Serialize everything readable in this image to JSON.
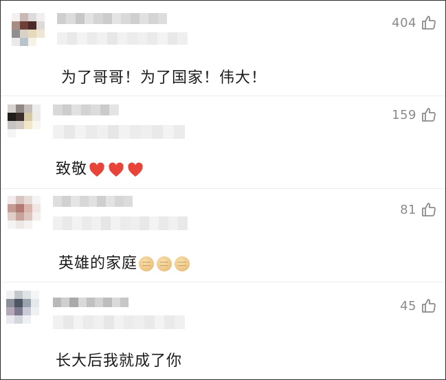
{
  "comments": [
    {
      "likes": "404",
      "text": "为了哥哥！为了国家！伟大！",
      "emoji": [],
      "avatar_colors": [
        [
          "#f4f0ef",
          "#c9b8b3",
          "#dcdcdc",
          "#f0eeee",
          "#ffffff"
        ],
        [
          "#a68c82",
          "#6f3e37",
          "#4a2b2a",
          "#dedad7",
          "#ffffff"
        ],
        [
          "#8f8f90",
          "#d7d1c8",
          "#e8d9ba",
          "#efe5d3",
          "#ffffff"
        ],
        [
          "#e8eaec",
          "#b8c3cb",
          "#f6f2e7",
          "#ffffff",
          "#ffffff"
        ],
        [
          "#ffffff",
          "#ffffff",
          "#ffffff",
          "#ffffff",
          "#ffffff"
        ]
      ],
      "name_blur": [
        "#cfcfcf",
        "#dcdcdc",
        "#c7c7c7",
        "#e2e2e2",
        "#d5d5d5",
        "#cccccc",
        "#e4e4e4",
        "#d9d9d9",
        "#cfcfcf",
        "#e0e0e0",
        "#d4d4d4",
        "#dddddd"
      ],
      "sub_blur": [
        "#f0f0f0",
        "#e9e9e9",
        "#f3f3f3",
        "#ebebeb",
        "#f1f1f1",
        "#e7e7e7",
        "#f2f2f2",
        "#ececec",
        "#f0f0f0",
        "#eaeaea",
        "#f3f3f3",
        "#e8e8e8",
        "#efefef"
      ]
    },
    {
      "likes": "159",
      "text": "致敬",
      "emoji": [
        "heart",
        "heart",
        "heart"
      ],
      "avatar_colors": [
        [
          "#d7d2cf",
          "#8f8884",
          "#c4bdb8",
          "#ececec",
          "#ffffff"
        ],
        [
          "#1f1c1c",
          "#3d2d2b",
          "#d8c9a5",
          "#ecebe7",
          "#ffffff"
        ],
        [
          "#c6c3c2",
          "#d2cbc4",
          "#f2e7c6",
          "#f8f6f1",
          "#ffffff"
        ],
        [
          "#f4f4f4",
          "#ffffff",
          "#ffffff",
          "#ffffff",
          "#ffffff"
        ],
        [
          "#ffffff",
          "#ffffff",
          "#ffffff",
          "#ffffff",
          "#ffffff"
        ]
      ],
      "name_blur": [
        "#d9d9d9",
        "#cdcdcd",
        "#e1e1e1",
        "#d3d3d3",
        "#dcdcdc",
        "#cbcbcb",
        "#e4e4e4"
      ],
      "sub_blur": [
        "#f1f1f1",
        "#e8e8e8",
        "#f3f3f3",
        "#ebebeb",
        "#f0f0f0",
        "#e6e6e6",
        "#f2f2f2",
        "#ececec",
        "#efefef",
        "#e9e9e9",
        "#f3f3f3",
        "#ebebeb"
      ]
    },
    {
      "likes": "81",
      "text": "英雄的家庭",
      "emoji": [
        "fist",
        "fist",
        "fist"
      ],
      "avatar_colors": [
        [
          "#f1eceb",
          "#d8c5c0",
          "#e6dcd8",
          "#f4f4f4",
          "#ffffff"
        ],
        [
          "#c49a92",
          "#b27c74",
          "#d9b6ad",
          "#efe6e3",
          "#ffffff"
        ],
        [
          "#e0cfc9",
          "#c7a39c",
          "#dcc5bf",
          "#f3efee",
          "#ffffff"
        ],
        [
          "#f6f4f3",
          "#ede7e5",
          "#f5f2f1",
          "#ffffff",
          "#ffffff"
        ],
        [
          "#ffffff",
          "#ffffff",
          "#ffffff",
          "#ffffff",
          "#ffffff"
        ]
      ],
      "name_blur": [
        "#dedede",
        "#d1d1d1",
        "#e5e5e5",
        "#d7d7d7",
        "#e1e1e1",
        "#cfcfcf",
        "#e3e3e3",
        "#d6d6d6",
        "#dcdcdc"
      ],
      "sub_blur": [
        "#f0f0f0",
        "#e9e9e9",
        "#f3f3f3",
        "#ebebeb",
        "#f1f1f1",
        "#e6e6e6",
        "#f2f2f2",
        "#ececec",
        "#efefef",
        "#e8e8e8",
        "#f3f3f3",
        "#eaeaea",
        "#f0f0f0",
        "#e9e9e9"
      ]
    },
    {
      "likes": "45",
      "text": "长大后我就成了你",
      "emoji": [],
      "avatar_colors": [
        [
          "#eef0f2",
          "#c3c8cd",
          "#dfe3e6",
          "#f4f5f6",
          "#ffffff"
        ],
        [
          "#8a8f9c",
          "#4e5663",
          "#9aa3ae",
          "#e6e9ec",
          "#ffffff"
        ],
        [
          "#b4a8b9",
          "#7d7a8f",
          "#c9cbd6",
          "#eef0f3",
          "#ffffff"
        ],
        [
          "#e9e8ee",
          "#d4d6de",
          "#eef0f4",
          "#ffffff",
          "#ffffff"
        ],
        [
          "#ffffff",
          "#ffffff",
          "#ffffff",
          "#ffffff",
          "#ffffff"
        ]
      ],
      "name_blur": [
        "#b9b9b9",
        "#cfcfcf",
        "#a9a9a9",
        "#d9d9d9",
        "#c1c1c1",
        "#d3d3d3",
        "#bdbdbd",
        "#dadada",
        "#c7c7c7"
      ],
      "sub_blur": [
        "#f1f1f1",
        "#e8e8e8",
        "#f3f3f3",
        "#ebebeb",
        "#f0f0f0",
        "#e7e7e7",
        "#f2f2f2",
        "#ececec",
        "#efefef",
        "#e9e9e9",
        "#f3f3f3",
        "#eaeaea",
        "#f0f0f0"
      ]
    }
  ],
  "colors": {
    "text": "#1a1a1a",
    "muted": "#8a8a8a",
    "divider": "#ececec",
    "heart": "#e8443a"
  },
  "icons": {
    "like": "thumbs-up-outline-icon",
    "heart": "red-heart-emoji",
    "fist": "raised-fist-emoji"
  }
}
